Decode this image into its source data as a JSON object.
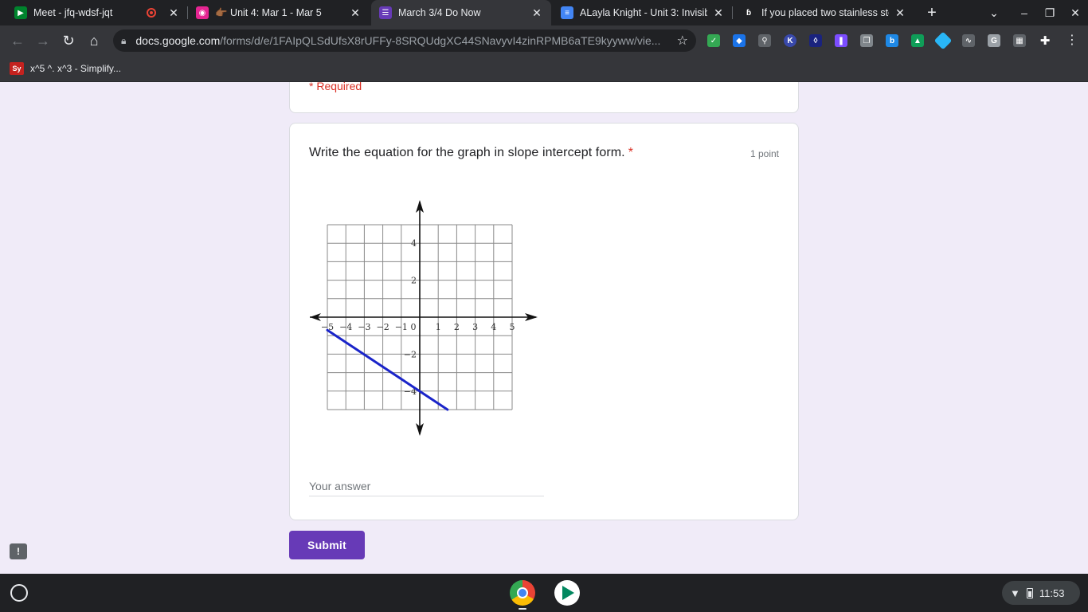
{
  "browser": {
    "tabs": [
      {
        "title": "Meet - jfq-wdsf-jqt",
        "favicon": "meet-icon",
        "recording": true,
        "active": false
      },
      {
        "title": "👉🏾 Unit 4: Mar 1 - Mar 5",
        "favicon": "classroom-icon",
        "active": false
      },
      {
        "title": "March 3/4 Do Now",
        "favicon": "forms-icon",
        "active": true
      },
      {
        "title": "ALayla Knight - Unit 3: Invisible",
        "favicon": "docs-icon",
        "active": false
      },
      {
        "title": "If you placed two stainless steel",
        "favicon": "brainly-icon",
        "active": false
      }
    ],
    "address": {
      "host": "docs.google.com",
      "path": "/forms/d/e/1FAIpQLSdUfsX8rUFFy-8SRQUdgXC44SNavyvI4zinRPMB6aTE9kyyww/vie..."
    },
    "bookmarks": [
      {
        "label": "x^5 ^. x^3 - Simplify...",
        "favicon_text": "Sy"
      }
    ]
  },
  "form": {
    "required_note": "* Required",
    "question": {
      "title": "Write the equation for the graph in slope intercept form.",
      "required_mark": "*",
      "points": "1 point",
      "answer_placeholder": "Your answer"
    },
    "submit_label": "Submit"
  },
  "chart_data": {
    "type": "line",
    "xlim": [
      -5,
      5
    ],
    "ylim": [
      -5,
      5
    ],
    "x_tick_labels": [
      "−5",
      "−4",
      "−3",
      "−2",
      "−1",
      "0",
      "1",
      "2",
      "3",
      "4",
      "5"
    ],
    "y_tick_labels": [
      "4",
      "2",
      "−2",
      "−4"
    ],
    "grid": true,
    "series": [
      {
        "x": [
          -5,
          1.5
        ],
        "y": [
          -0.7,
          -5
        ],
        "color": "#1a24c9"
      }
    ]
  },
  "system": {
    "clock": "11:53"
  },
  "colors": {
    "form_accent": "#673ab7",
    "page_bg": "#f0ebf8",
    "required": "#d93025",
    "line": "#1a24c9"
  }
}
